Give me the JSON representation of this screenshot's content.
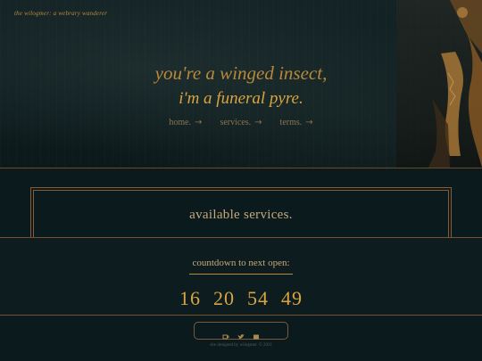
{
  "header": {
    "brand": "the wilogmer: a webrary wanderer"
  },
  "hero": {
    "line1": "you're a winged insect,",
    "line2": "i'm a funeral pyre."
  },
  "nav": [
    {
      "label": "home.",
      "icon": "arrow-right-icon"
    },
    {
      "label": "services.",
      "icon": "arrow-right-icon"
    },
    {
      "label": "terms.",
      "icon": "arrow-right-icon"
    }
  ],
  "services": {
    "title": "available services."
  },
  "countdown": {
    "label": "countdown to next open:",
    "values": [
      "16",
      "20",
      "54",
      "49"
    ]
  },
  "footer": {
    "social_icons": [
      "ko-fi-icon",
      "twitter-icon",
      "mail-icon"
    ],
    "credit": "site designed by wilogmer. © 2021"
  },
  "colors": {
    "background": "#0b1a1c",
    "accent": "#d9a441",
    "border": "#8a5a34"
  }
}
